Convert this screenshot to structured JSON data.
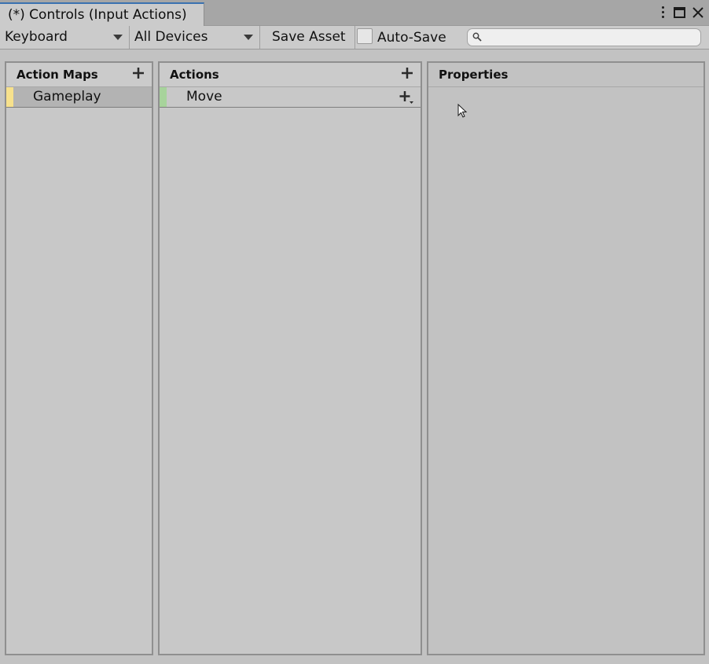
{
  "window": {
    "tab_title": "(*) Controls (Input Actions)"
  },
  "toolbar": {
    "control_scheme": "Keyboard",
    "device": "All Devices",
    "save_label": "Save Asset",
    "auto_save_label": "Auto-Save",
    "auto_save_checked": false,
    "search_placeholder": "",
    "search_value": ""
  },
  "action_maps": {
    "title": "Action Maps",
    "items": [
      {
        "label": "Gameplay",
        "color": "#f7e18c",
        "selected": true
      }
    ]
  },
  "actions": {
    "title": "Actions",
    "items": [
      {
        "label": "Move",
        "color": "#a7d39b"
      }
    ]
  },
  "properties": {
    "title": "Properties"
  },
  "icons": {
    "menu": "kebab-menu-icon",
    "maximize": "maximize-icon",
    "close": "close-icon",
    "search": "search-icon",
    "add": "plus-icon",
    "add_dropdown": "plus-dropdown-icon",
    "cursor": "mouse-cursor-icon"
  },
  "colors": {
    "accent": "#3a72b0",
    "selection": "#b3b3b3",
    "panel_bg": "#c8c8c8"
  }
}
